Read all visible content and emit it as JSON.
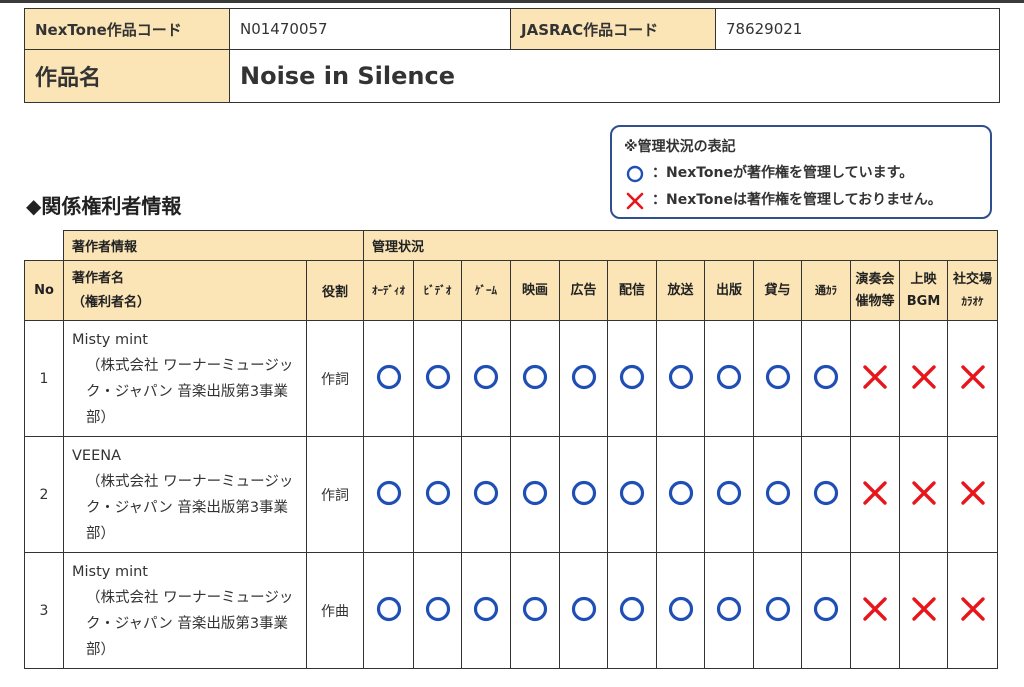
{
  "work": {
    "nextone_code_label": "NexTone作品コード",
    "nextone_code": "N01470057",
    "jasrac_code_label": "JASRAC作品コード",
    "jasrac_code": "78629021",
    "title_label": "作品名",
    "title": "Noise in Silence"
  },
  "legend": {
    "heading": "※管理状況の表記",
    "managed": "：NexToneが著作権を管理しています。",
    "not_managed": "：NexToneは著作権を管理しておりません。"
  },
  "section_title": "◆関係権利者情報",
  "table": {
    "author_info_header": "著作者情報",
    "status_header": "管理状況",
    "no_header": "No",
    "name_header_1": "著作者名",
    "name_header_2": "（権利者名）",
    "role_header": "役割",
    "columns": [
      {
        "l1": "ｵｰﾃﾞｨｵ",
        "l2": ""
      },
      {
        "l1": "ﾋﾞﾃﾞｵ",
        "l2": ""
      },
      {
        "l1": "ｹﾞｰﾑ",
        "l2": ""
      },
      {
        "l1": "映画",
        "l2": ""
      },
      {
        "l1": "広告",
        "l2": ""
      },
      {
        "l1": "配信",
        "l2": ""
      },
      {
        "l1": "放送",
        "l2": ""
      },
      {
        "l1": "出版",
        "l2": ""
      },
      {
        "l1": "貸与",
        "l2": ""
      },
      {
        "l1": "通ｶﾗ",
        "l2": ""
      },
      {
        "l1": "演奏会",
        "l2": "催物等"
      },
      {
        "l1": "上映",
        "l2": "BGM"
      },
      {
        "l1": "社交場",
        "l2": "ｶﾗｵｹ"
      }
    ],
    "rows": [
      {
        "no": "1",
        "name": "Misty mint",
        "publisher": "（株式会社 ワーナーミュージック・ジャパン 音楽出版第3事業部）",
        "role": "作詞",
        "status": [
          "managed",
          "managed",
          "managed",
          "managed",
          "managed",
          "managed",
          "managed",
          "managed",
          "managed",
          "managed",
          "not_managed",
          "not_managed",
          "not_managed"
        ]
      },
      {
        "no": "2",
        "name": "VEENA",
        "publisher": "（株式会社 ワーナーミュージック・ジャパン 音楽出版第3事業部）",
        "role": "作詞",
        "status": [
          "managed",
          "managed",
          "managed",
          "managed",
          "managed",
          "managed",
          "managed",
          "managed",
          "managed",
          "managed",
          "not_managed",
          "not_managed",
          "not_managed"
        ]
      },
      {
        "no": "3",
        "name": "Misty mint",
        "publisher": "（株式会社 ワーナーミュージック・ジャパン 音楽出版第3事業部）",
        "role": "作曲",
        "status": [
          "managed",
          "managed",
          "managed",
          "managed",
          "managed",
          "managed",
          "managed",
          "managed",
          "managed",
          "managed",
          "not_managed",
          "not_managed",
          "not_managed"
        ]
      }
    ]
  },
  "colors": {
    "header_bg": "#fbe5b6",
    "managed_mark": "#1f4fb5",
    "not_managed_mark": "#e8161b",
    "legend_border": "#2f4f8f"
  },
  "icons": {
    "managed": "circle-icon",
    "not_managed": "cross-icon"
  }
}
